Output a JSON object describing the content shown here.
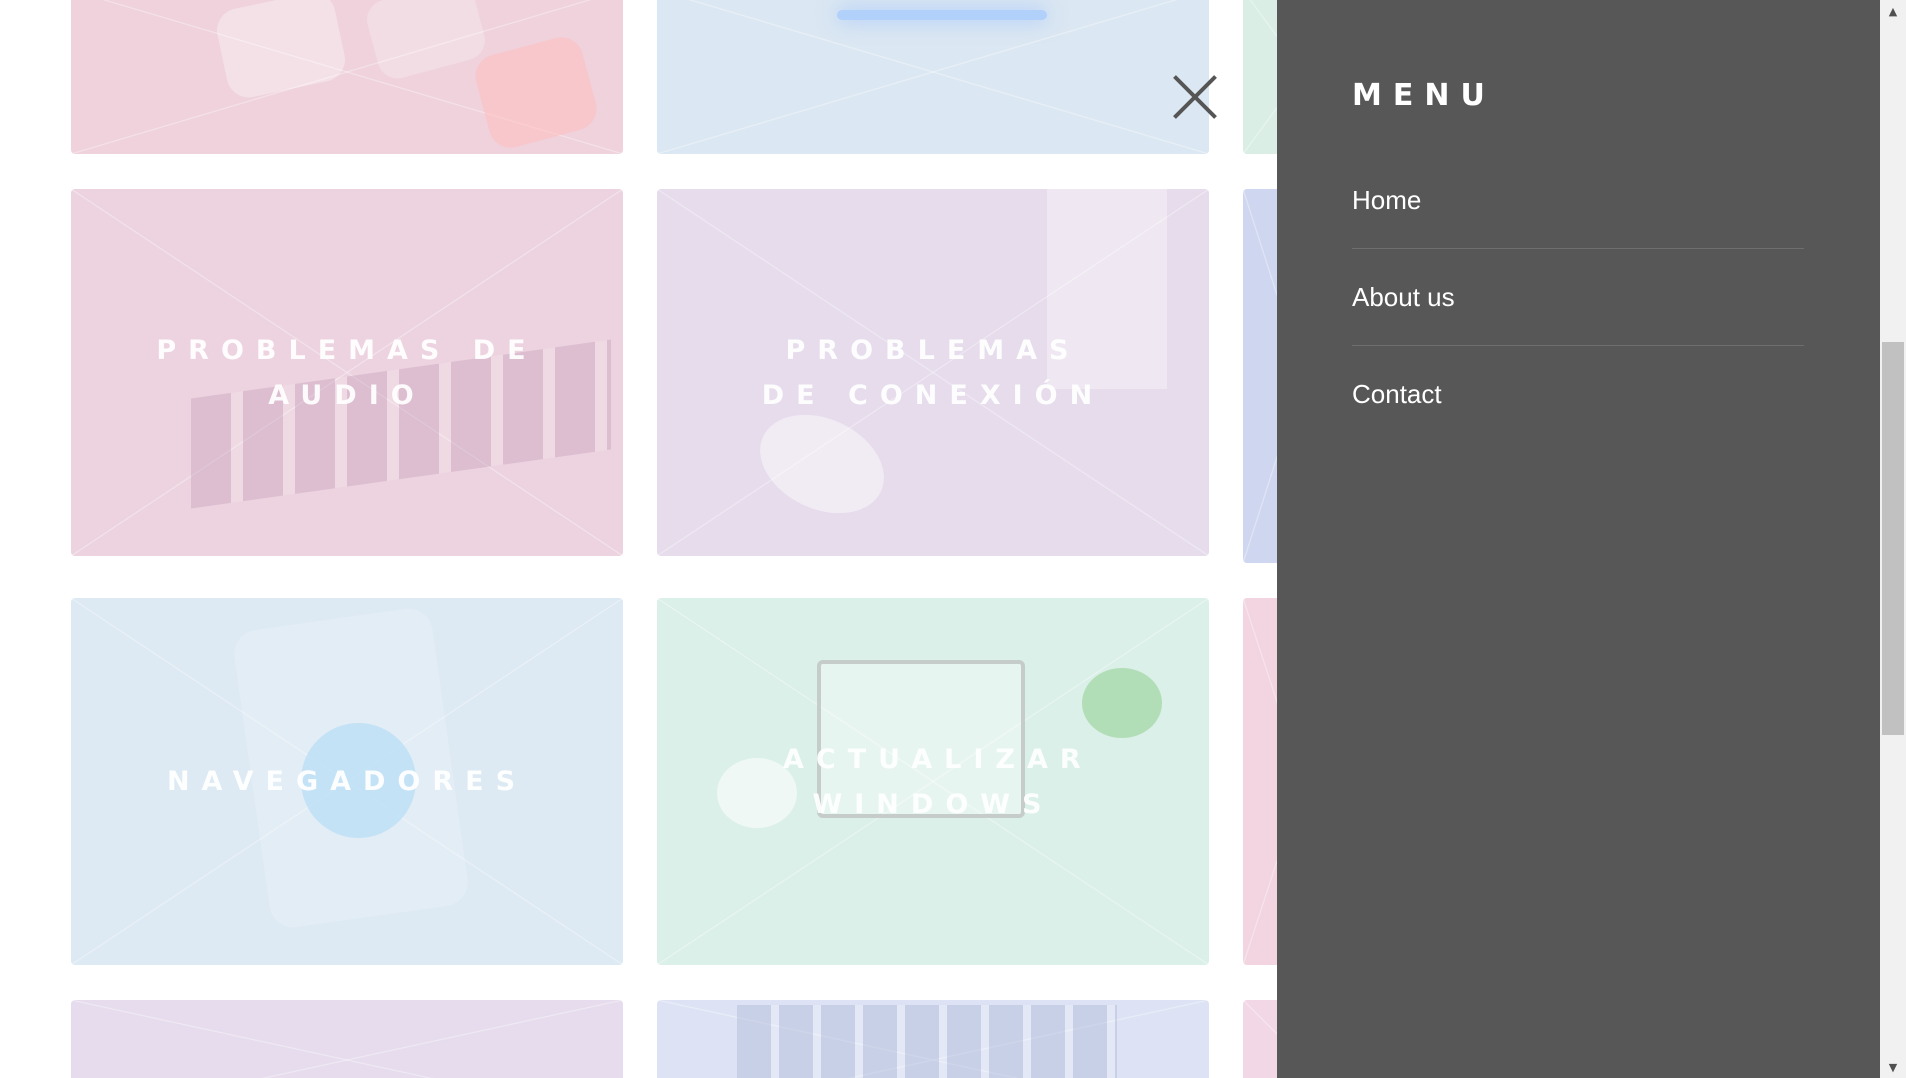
{
  "tiles": {
    "row0": [
      {
        "title": "",
        "decor": "social-media-icons"
      },
      {
        "title": "",
        "decor": "light-blue-photo"
      },
      {
        "title": "",
        "decor": "mint-photo"
      }
    ],
    "row1": [
      {
        "title": "Problemas de audio",
        "decor": "audio-mixer-photo"
      },
      {
        "title": "Problemas de conexión",
        "decor": "mouse-desk-photo"
      },
      {
        "title": "",
        "decor": "blue-photo"
      }
    ],
    "row2": [
      {
        "title": "Navegadores",
        "decor": "chrome-logo-photo"
      },
      {
        "title": "Actualizar Windows",
        "decor": "laptop-desk-photo"
      },
      {
        "title": "",
        "decor": "pink-photo"
      }
    ],
    "row3": [
      {
        "title": "",
        "decor": "lavender-photo"
      },
      {
        "title": "",
        "decor": "keyboard-photo"
      },
      {
        "title": "",
        "decor": "pink-photo"
      }
    ]
  },
  "colors": {
    "menu_bg": "#575757",
    "close_icon": "#555555",
    "tile_pink": "#ecd1de",
    "tile_lavender": "#e6dcec",
    "tile_blue": "#dbe9f3",
    "tile_mint": "#dbf0e8",
    "tile_periwinkle": "#dde3f4"
  },
  "close": {
    "icon": "close-icon"
  },
  "menu": {
    "heading": "MENU",
    "items": [
      {
        "label": "Home"
      },
      {
        "label": "About us"
      },
      {
        "label": "Contact"
      }
    ]
  },
  "scrollbar": {
    "up_icon": "▲",
    "down_icon": "▼"
  }
}
